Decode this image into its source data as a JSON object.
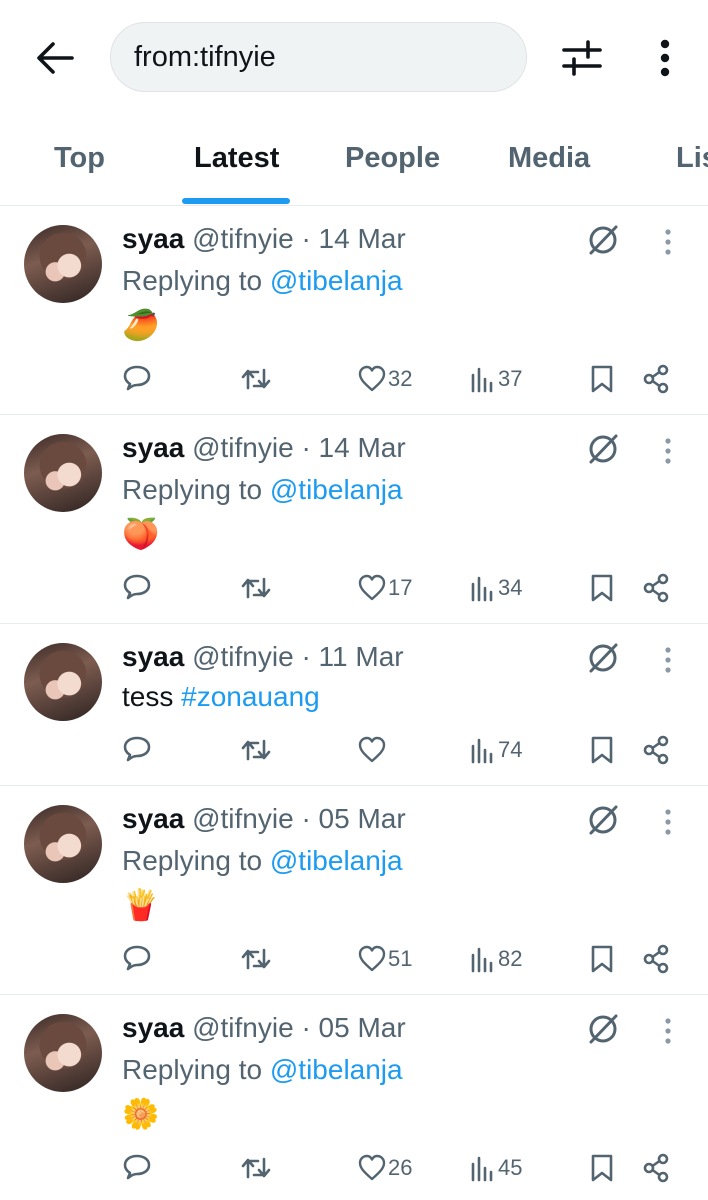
{
  "search": {
    "query": "from:tifnyie"
  },
  "tabs": [
    {
      "label": "Top"
    },
    {
      "label": "Latest"
    },
    {
      "label": "People"
    },
    {
      "label": "Media"
    },
    {
      "label": "Lists"
    }
  ],
  "tweets": [
    {
      "name": "syaa",
      "handle": "@tifnyie",
      "dot": "·",
      "date": "14 Mar",
      "reply_prefix": "Replying to",
      "mention": "@tibelanja",
      "emoji": "🥭",
      "likes": "32",
      "views": "37"
    },
    {
      "name": "syaa",
      "handle": "@tifnyie",
      "dot": "·",
      "date": "14 Mar",
      "reply_prefix": "Replying to",
      "mention": "@tibelanja",
      "emoji": "🍑",
      "likes": "17",
      "views": "34"
    },
    {
      "name": "syaa",
      "handle": "@tifnyie",
      "dot": "·",
      "date": "11 Mar",
      "text": "tess",
      "hashtag": "#zonauang",
      "likes": "",
      "views": "74"
    },
    {
      "name": "syaa",
      "handle": "@tifnyie",
      "dot": "·",
      "date": "05 Mar",
      "reply_prefix": "Replying to",
      "mention": "@tibelanja",
      "emoji": "🍟",
      "likes": "51",
      "views": "82"
    },
    {
      "name": "syaa",
      "handle": "@tifnyie",
      "dot": "·",
      "date": "05 Mar",
      "reply_prefix": "Replying to",
      "mention": "@tibelanja",
      "emoji": "🌼",
      "likes": "26",
      "views": "45"
    }
  ],
  "icons": {
    "back": "arrow-left-icon",
    "filter": "sliders-icon",
    "more": "more-vertical-icon",
    "reply": "reply-icon",
    "retweet": "retweet-icon",
    "like": "heart-icon",
    "views": "views-chart-icon",
    "bookmark": "bookmark-icon",
    "share": "share-icon",
    "grok": "grok-icon",
    "tweet_more": "more-vertical-icon"
  },
  "colors": {
    "accent": "#1d9bf0",
    "text_primary": "#0f1419",
    "text_secondary": "#536471",
    "search_bg": "#eff3f4",
    "divider": "#e6ecf0"
  }
}
